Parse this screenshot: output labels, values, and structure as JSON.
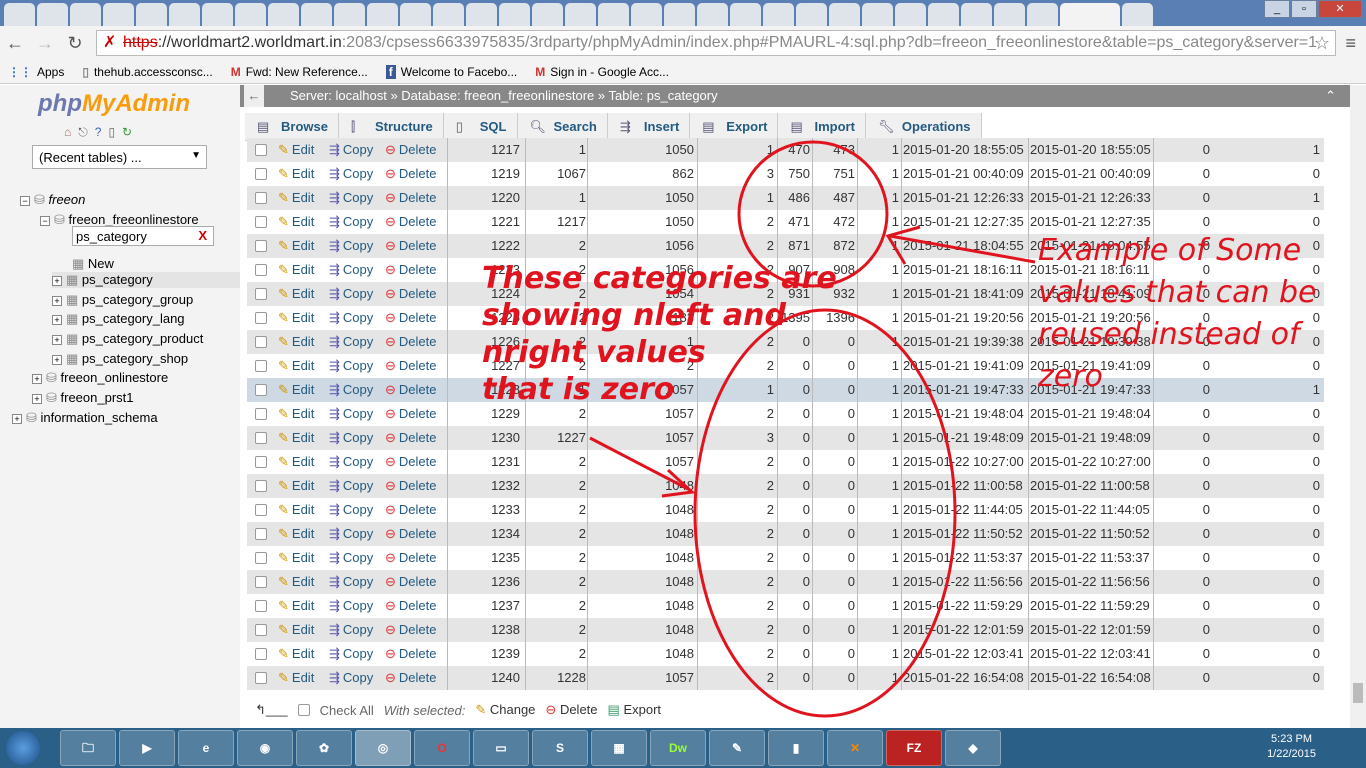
{
  "browser": {
    "url_struck": "https",
    "url_host": "://worldmart2.worldmart.in",
    "url_rest": ":2083/cpsess6633975835/3rdparty/phpMyAdmin/index.php#PMAURL-4:sql.php?db=freeon_freeonlinestore&table=ps_category&server=1",
    "bookmarks": [
      "Apps",
      "thehub.accessconsc...",
      "Fwd: New Reference...",
      "Welcome to Facebo...",
      "Sign in - Google Acc..."
    ]
  },
  "sidebar": {
    "logo_php": "php",
    "logo_admin": "MyAdmin",
    "recent": "(Recent tables) ...",
    "filter_value": "ps_category",
    "filter_clear": "X",
    "tree": [
      {
        "label": "freeon"
      },
      {
        "label": "freeon_freeonlinestore"
      },
      {
        "label": "New"
      },
      {
        "label": "ps_category"
      },
      {
        "label": "ps_category_group"
      },
      {
        "label": "ps_category_lang"
      },
      {
        "label": "ps_category_product"
      },
      {
        "label": "ps_category_shop"
      },
      {
        "label": "freeon_onlinestore"
      },
      {
        "label": "freeon_prst1"
      },
      {
        "label": "information_schema"
      }
    ]
  },
  "breadcrumb": {
    "server": "Server: localhost",
    "database": "Database: freeon_freeonlinestore",
    "table": "Table: ps_category"
  },
  "menu": [
    "Browse",
    "Structure",
    "SQL",
    "Search",
    "Insert",
    "Export",
    "Import",
    "Operations"
  ],
  "actions": {
    "edit": "Edit",
    "copy": "Copy",
    "delete": "Delete"
  },
  "rows": [
    [
      "1217",
      "1",
      "1050",
      "1",
      "470",
      "473",
      "1",
      "2015-01-20 18:55:05",
      "2015-01-20 18:55:05",
      "0",
      "1"
    ],
    [
      "1219",
      "1067",
      "862",
      "3",
      "750",
      "751",
      "1",
      "2015-01-21 00:40:09",
      "2015-01-21 00:40:09",
      "0",
      "0"
    ],
    [
      "1220",
      "1",
      "1050",
      "1",
      "486",
      "487",
      "1",
      "2015-01-21 12:26:33",
      "2015-01-21 12:26:33",
      "0",
      "1"
    ],
    [
      "1221",
      "1217",
      "1050",
      "2",
      "471",
      "472",
      "1",
      "2015-01-21 12:27:35",
      "2015-01-21 12:27:35",
      "0",
      "0"
    ],
    [
      "1222",
      "2",
      "1056",
      "2",
      "871",
      "872",
      "1",
      "2015-01-21 18:04:55",
      "2015-01-21 18:04:55",
      "0",
      "0"
    ],
    [
      "1223",
      "2",
      "1056",
      "2",
      "907",
      "908",
      "1",
      "2015-01-21 18:16:11",
      "2015-01-21 18:16:11",
      "0",
      "0"
    ],
    [
      "1224",
      "2",
      "1054",
      "2",
      "931",
      "932",
      "1",
      "2015-01-21 18:41:09",
      "2015-01-21 18:41:09",
      "0",
      "0"
    ],
    [
      "1225",
      "2",
      "1183",
      "2",
      "1395",
      "1396",
      "1",
      "2015-01-21 19:20:56",
      "2015-01-21 19:20:56",
      "0",
      "0"
    ],
    [
      "1226",
      "2",
      "1",
      "2",
      "0",
      "0",
      "1",
      "2015-01-21 19:39:38",
      "2015-01-21 19:39:38",
      "0",
      "0"
    ],
    [
      "1227",
      "2",
      "2",
      "2",
      "0",
      "0",
      "1",
      "2015-01-21 19:41:09",
      "2015-01-21 19:41:09",
      "0",
      "0"
    ],
    [
      "1228",
      "1",
      "1057",
      "1",
      "0",
      "0",
      "1",
      "2015-01-21 19:47:33",
      "2015-01-21 19:47:33",
      "0",
      "1"
    ],
    [
      "1229",
      "2",
      "1057",
      "2",
      "0",
      "0",
      "1",
      "2015-01-21 19:48:04",
      "2015-01-21 19:48:04",
      "0",
      "0"
    ],
    [
      "1230",
      "1227",
      "1057",
      "3",
      "0",
      "0",
      "1",
      "2015-01-21 19:48:09",
      "2015-01-21 19:48:09",
      "0",
      "0"
    ],
    [
      "1231",
      "2",
      "1057",
      "2",
      "0",
      "0",
      "1",
      "2015-01-22 10:27:00",
      "2015-01-22 10:27:00",
      "0",
      "0"
    ],
    [
      "1232",
      "2",
      "1048",
      "2",
      "0",
      "0",
      "1",
      "2015-01-22 11:00:58",
      "2015-01-22 11:00:58",
      "0",
      "0"
    ],
    [
      "1233",
      "2",
      "1048",
      "2",
      "0",
      "0",
      "1",
      "2015-01-22 11:44:05",
      "2015-01-22 11:44:05",
      "0",
      "0"
    ],
    [
      "1234",
      "2",
      "1048",
      "2",
      "0",
      "0",
      "1",
      "2015-01-22 11:50:52",
      "2015-01-22 11:50:52",
      "0",
      "0"
    ],
    [
      "1235",
      "2",
      "1048",
      "2",
      "0",
      "0",
      "1",
      "2015-01-22 11:53:37",
      "2015-01-22 11:53:37",
      "0",
      "0"
    ],
    [
      "1236",
      "2",
      "1048",
      "2",
      "0",
      "0",
      "1",
      "2015-01-22 11:56:56",
      "2015-01-22 11:56:56",
      "0",
      "0"
    ],
    [
      "1237",
      "2",
      "1048",
      "2",
      "0",
      "0",
      "1",
      "2015-01-22 11:59:29",
      "2015-01-22 11:59:29",
      "0",
      "0"
    ],
    [
      "1238",
      "2",
      "1048",
      "2",
      "0",
      "0",
      "1",
      "2015-01-22 12:01:59",
      "2015-01-22 12:01:59",
      "0",
      "0"
    ],
    [
      "1239",
      "2",
      "1048",
      "2",
      "0",
      "0",
      "1",
      "2015-01-22 12:03:41",
      "2015-01-22 12:03:41",
      "0",
      "0"
    ],
    [
      "1240",
      "1228",
      "1057",
      "2",
      "0",
      "0",
      "1",
      "2015-01-22 16:54:08",
      "2015-01-22 16:54:08",
      "0",
      "0"
    ]
  ],
  "footer": {
    "check_all": "Check All",
    "with_selected": "With selected:",
    "change": "Change",
    "delete": "Delete",
    "export": "Export"
  },
  "annotations": {
    "left": [
      "These categories are",
      "showing nleft and",
      "nright values",
      "that is zero"
    ],
    "right": [
      "Example of Some",
      "values that can be",
      "reused instead of",
      "zero"
    ],
    "color": "#e0141e"
  },
  "taskbar": {
    "time": "5:23 PM",
    "date": "1/22/2015",
    "apps": [
      "Dw",
      "FZ"
    ]
  }
}
